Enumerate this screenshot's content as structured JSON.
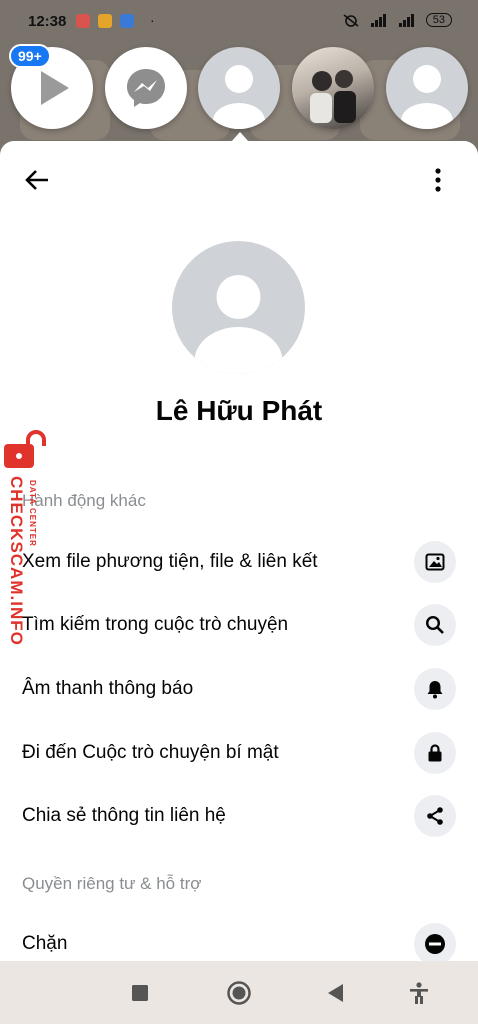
{
  "status_bar": {
    "time": "12:38",
    "dot": "·",
    "battery": "53"
  },
  "chat_heads": {
    "badge": "99+"
  },
  "profile": {
    "name": "Lê Hữu Phát"
  },
  "sections": {
    "more_actions": "Hành động khác",
    "privacy_support": "Quyền riêng tư & hỗ trợ"
  },
  "rows": [
    {
      "label": "Xem file phương tiện, file & liên kết",
      "icon": "image-icon"
    },
    {
      "label": "Tìm kiếm trong cuộc trò chuyện",
      "icon": "search-icon"
    },
    {
      "label": "Âm thanh thông báo",
      "icon": "bell-icon"
    },
    {
      "label": "Đi đến Cuộc trò chuyện bí mật",
      "icon": "lock-icon"
    },
    {
      "label": "Chia sẻ thông tin liên hệ",
      "icon": "share-icon"
    },
    {
      "label": "Chặn",
      "icon": "block-icon"
    }
  ],
  "watermark": {
    "brand": "CHECKSCAM.INFO",
    "sub": "DATA CENTER"
  },
  "colors": {
    "accent": "#1877f2",
    "watermark": "#e0332c",
    "icon_bg": "#eceef1"
  }
}
